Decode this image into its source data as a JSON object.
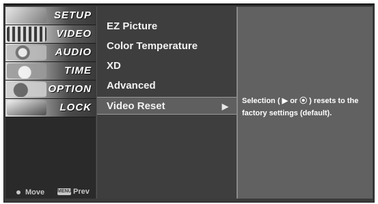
{
  "menu": {
    "items": [
      {
        "label": "SETUP",
        "icon": "setup-thumbnail-icon"
      },
      {
        "label": "VIDEO",
        "icon": "video-thumbnail-icon"
      },
      {
        "label": "AUDIO",
        "icon": "audio-thumbnail-icon"
      },
      {
        "label": "TIME",
        "icon": "time-thumbnail-icon"
      },
      {
        "label": "OPTION",
        "icon": "option-thumbnail-icon"
      },
      {
        "label": "LOCK",
        "icon": "lock-thumbnail-icon"
      }
    ],
    "selected_index": 1
  },
  "hints": {
    "move_label": "Move",
    "prev_key": "MENU",
    "prev_label": "Prev"
  },
  "submenu": {
    "items": [
      {
        "label": "EZ Picture"
      },
      {
        "label": "Color Temperature"
      },
      {
        "label": "XD"
      },
      {
        "label": "Advanced"
      },
      {
        "label": "Video Reset"
      }
    ],
    "active_index": 4,
    "active_arrow": "▶"
  },
  "help": {
    "text": "Selection ( ▶ or ⦿ ) resets to the factory settings (default)."
  },
  "colors": {
    "panel": "#3b3b3b",
    "highlight": "#5f5f5f",
    "help_bg": "#616161"
  }
}
